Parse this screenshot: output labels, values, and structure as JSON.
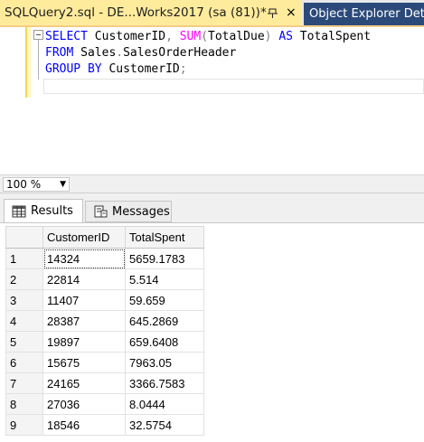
{
  "tabs": {
    "active_title": "SQLQuery2.sql - DE...Works2017 (sa (81))*",
    "close_glyph": "×",
    "inactive_title": "Object Explorer Det"
  },
  "editor": {
    "lines": [
      {
        "parts": [
          {
            "t": "SELECT",
            "c": "kw"
          },
          {
            "t": " CustomerID",
            "c": ""
          },
          {
            "t": ",",
            "c": "gr"
          },
          {
            "t": " ",
            "c": ""
          },
          {
            "t": "SUM",
            "c": "fn"
          },
          {
            "t": "(",
            "c": "gr"
          },
          {
            "t": "TotalDue",
            "c": ""
          },
          {
            "t": ")",
            "c": "gr"
          },
          {
            "t": " ",
            "c": ""
          },
          {
            "t": "AS",
            "c": "kw"
          },
          {
            "t": " TotalSpent",
            "c": ""
          }
        ]
      },
      {
        "parts": [
          {
            "t": "FROM",
            "c": "kw"
          },
          {
            "t": " Sales",
            "c": ""
          },
          {
            "t": ".",
            "c": "gr"
          },
          {
            "t": "SalesOrderHeader",
            "c": ""
          }
        ]
      },
      {
        "parts": [
          {
            "t": "GROUP BY",
            "c": "kw"
          },
          {
            "t": " CustomerID",
            "c": ""
          },
          {
            "t": ";",
            "c": "gr"
          }
        ]
      }
    ]
  },
  "zoom": {
    "value": "100 %"
  },
  "result_tabs": {
    "results": "Results",
    "messages": "Messages"
  },
  "grid": {
    "headers": [
      "CustomerID",
      "TotalSpent"
    ],
    "rows": [
      [
        "1",
        "14324",
        "5659.1783"
      ],
      [
        "2",
        "22814",
        "5.514"
      ],
      [
        "3",
        "11407",
        "59.659"
      ],
      [
        "4",
        "28387",
        "645.2869"
      ],
      [
        "5",
        "19897",
        "659.6408"
      ],
      [
        "6",
        "15675",
        "7963.05"
      ],
      [
        "7",
        "24165",
        "3366.7583"
      ],
      [
        "8",
        "27036",
        "8.0444"
      ],
      [
        "9",
        "18546",
        "32.5754"
      ]
    ]
  }
}
